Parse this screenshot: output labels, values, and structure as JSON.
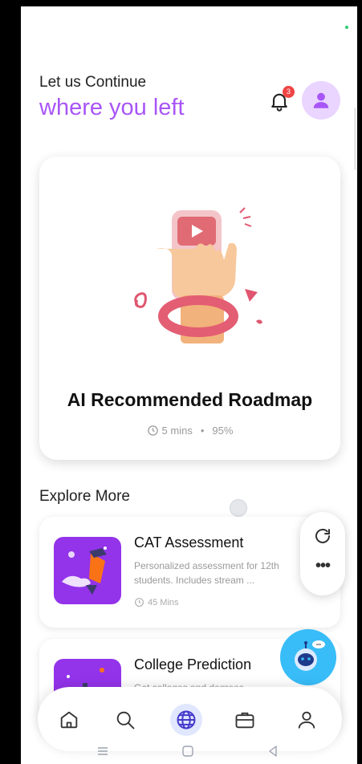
{
  "greeting": {
    "line1": "Let us Continue",
    "line2": "where you left"
  },
  "header": {
    "notification_count": "3"
  },
  "hero": {
    "title": "AI Recommended Roadmap",
    "duration": "5 mins",
    "separator": "•",
    "progress": "95%"
  },
  "explore": {
    "title": "Explore More",
    "cards": [
      {
        "title": "CAT Assessment",
        "description": "Personalized assessment for 12th students. Includes stream ...",
        "time": "45 Mins"
      },
      {
        "title": "College Prediction",
        "description": "Get colleges and degrees"
      }
    ]
  },
  "floating": {
    "more_label": "•••"
  },
  "nav": {
    "items": [
      "home-icon",
      "search-icon",
      "globe-icon",
      "briefcase-icon",
      "profile-icon"
    ],
    "active": "globe-icon"
  },
  "colors": {
    "accent": "#a855f7",
    "bot": "#38bdf8",
    "thumb": "#9333ea"
  }
}
